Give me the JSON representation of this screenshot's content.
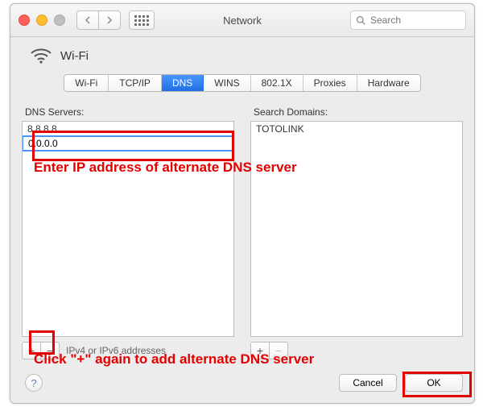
{
  "window": {
    "title": "Network"
  },
  "search": {
    "placeholder": "Search"
  },
  "header": {
    "connection_name": "Wi-Fi"
  },
  "tabs": {
    "items": [
      "Wi-Fi",
      "TCP/IP",
      "DNS",
      "WINS",
      "802.1X",
      "Proxies",
      "Hardware"
    ],
    "active_index": 2
  },
  "dns_panel": {
    "label": "DNS Servers:",
    "entries": [
      "8.8.8.8"
    ],
    "editing_value": "0.0.0.0",
    "hint": "IPv4 or IPv6 addresses"
  },
  "domains_panel": {
    "label": "Search Domains:",
    "entries": [
      "TOTOLINK"
    ]
  },
  "footer": {
    "cancel": "Cancel",
    "ok": "OK"
  },
  "annotations": {
    "line1": "Enter IP address of alternate DNS server",
    "line2": "Click \"+\" again to add alternate DNS server"
  },
  "icons": {
    "plus": "+",
    "minus": "−",
    "help": "?"
  }
}
